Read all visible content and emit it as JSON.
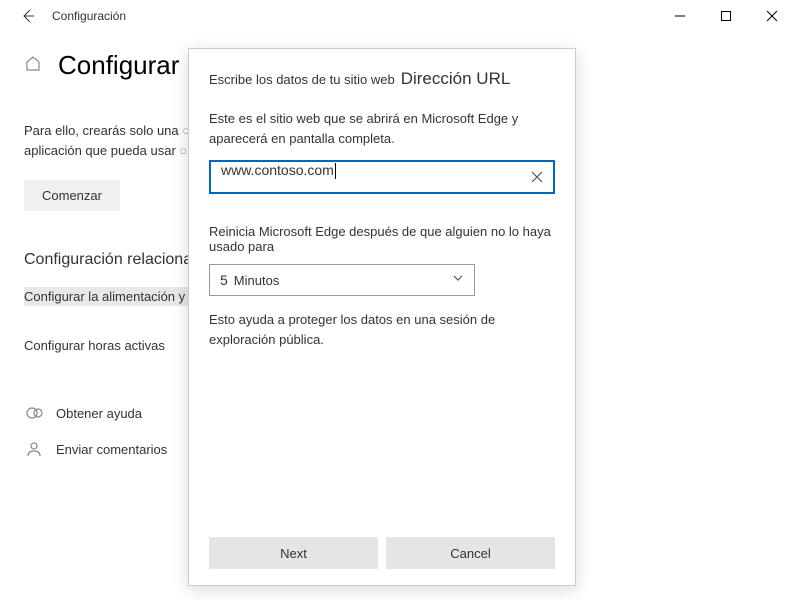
{
  "titlebar": {
    "title": "Configuración"
  },
  "page": {
    "heading": "Configurar un",
    "intro_line1": "Para ello, crearás solo una",
    "intro_line2": "aplicación que pueda usar",
    "begin_label": "Comenzar",
    "related_header": "Configuración relacionada",
    "related_link1": "Configurar la alimentación y el trineo",
    "related_link2": "Configurar horas activas",
    "help_label": "Obtener ayuda",
    "feedback_label": "Enviar comentarios"
  },
  "dialog": {
    "small_label": "Escribe los datos de tu sitio web",
    "big_label": "Dirección URL",
    "desc": "Este es el sitio web que se abrirá en Microsoft Edge y aparecerá en pantalla completa.",
    "url_value": "www.contoso.com",
    "restart_label": "Reinicia Microsoft Edge después de que alguien no lo haya usado para",
    "select_number": "5",
    "select_unit": "Minutos",
    "protect_text": "Esto ayuda a proteger los datos en una sesión de exploración pública.",
    "next_label": "Next",
    "cancel_label": "Cancel"
  }
}
